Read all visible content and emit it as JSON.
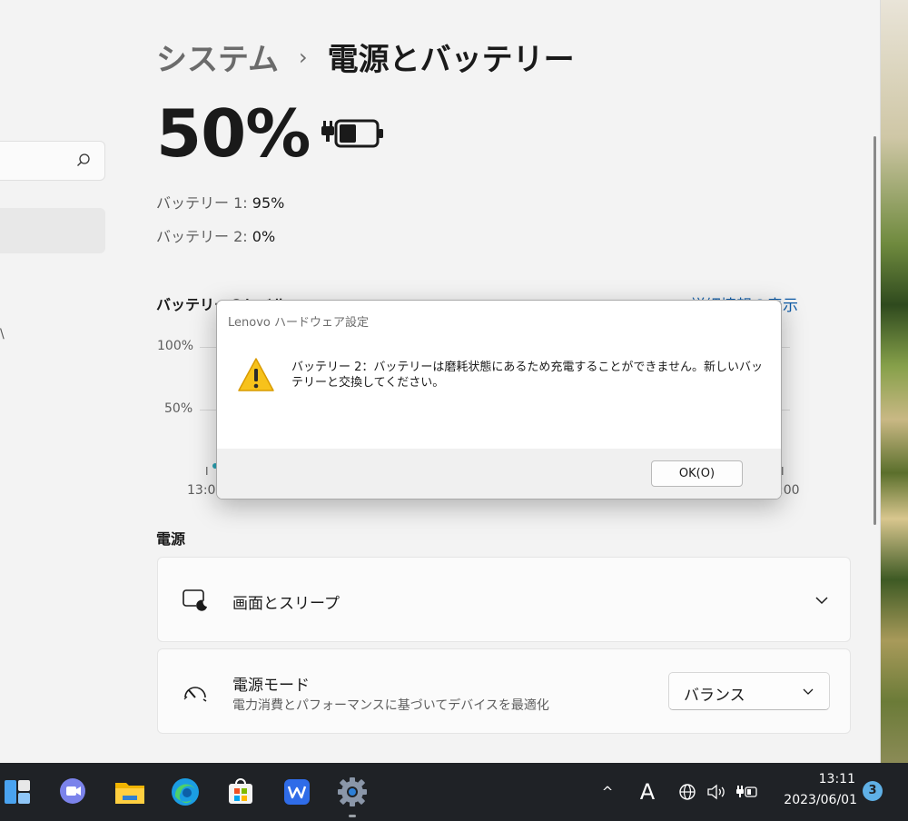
{
  "header": {
    "parent": "システム",
    "separator": "›",
    "current": "電源とバッテリー"
  },
  "battery": {
    "percent": "50%",
    "battery1_label": "バッテリー 1:",
    "battery1_value": "95%",
    "battery2_label": "バッテリー 2:",
    "battery2_value": "0%"
  },
  "levels": {
    "title": "バッテリーのレベル",
    "details_link": "詳細情報の表示",
    "y_top": "100%",
    "y_mid": "50%",
    "x_start": "13:0",
    "x_end": ":00",
    "tick_start": "I",
    "tick_end": "I"
  },
  "power": {
    "title": "電源",
    "sleep_label": "画面とスリープ",
    "mode_label": "電源モード",
    "mode_subtitle": "電力消費とパフォーマンスに基づいてデバイスを最適化",
    "mode_value": "バランス"
  },
  "dialog": {
    "title": "Lenovo ハードウェア設定",
    "message": "バッテリー 2：バッテリーは磨耗状態にあるため充電することができません。新しいバッテリーと交換してください。",
    "ok_label": "OK(O)"
  },
  "sidebar": {
    "mark": "\\"
  },
  "taskbar": {
    "ime": "A",
    "time": "13:11",
    "date": "2023/06/01",
    "notification_count": "3",
    "overflow": "^"
  }
}
